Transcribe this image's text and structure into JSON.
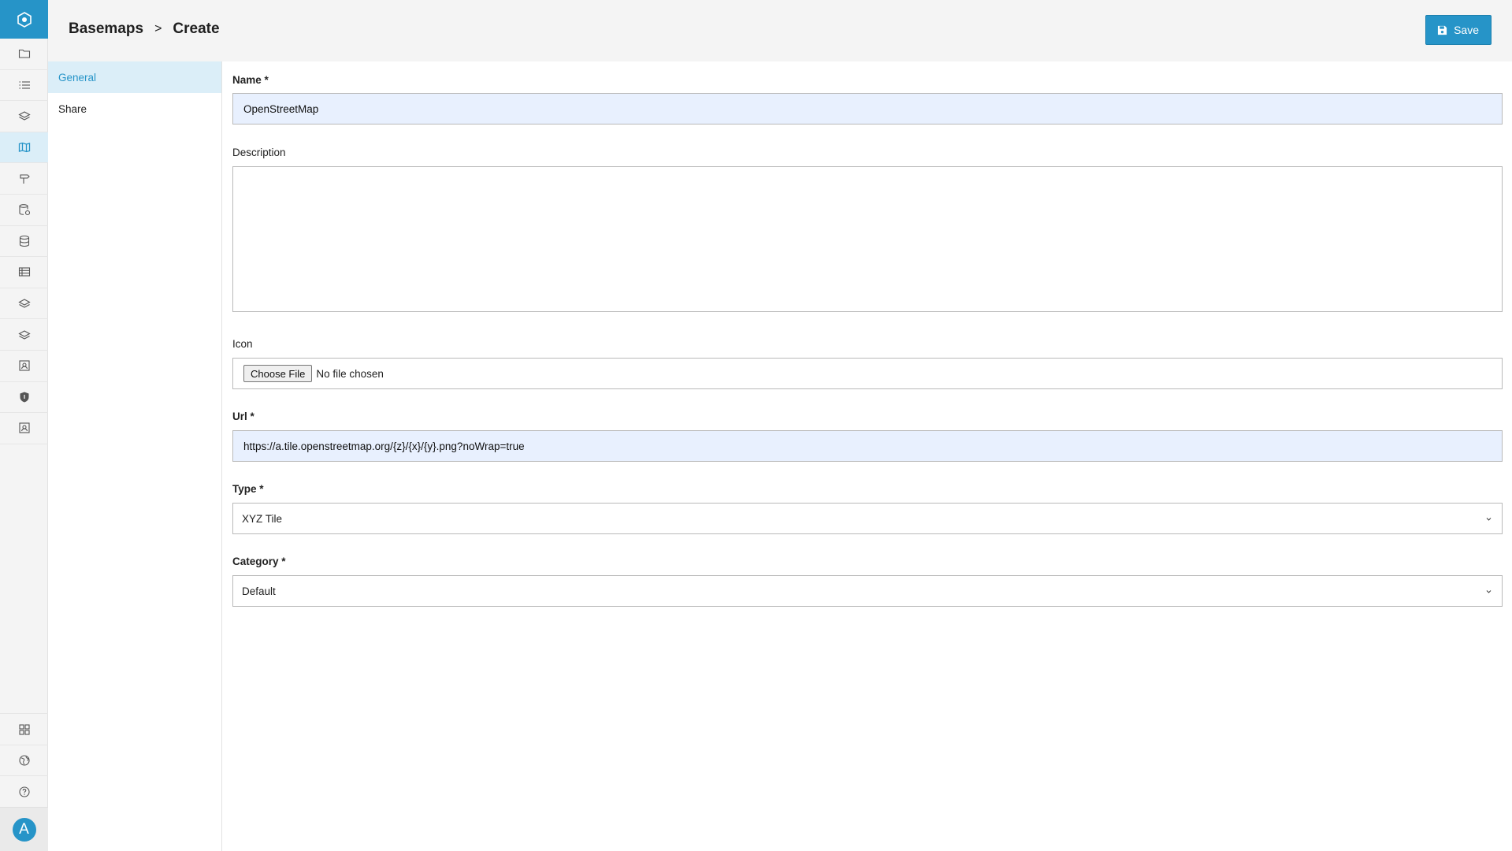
{
  "breadcrumb": {
    "root": "Basemaps",
    "separator": ">",
    "current": "Create"
  },
  "toolbar": {
    "save_label": "Save"
  },
  "subnav": {
    "items": [
      {
        "label": "General",
        "active": true
      },
      {
        "label": "Share",
        "active": false
      }
    ]
  },
  "rail": {
    "logo_icon": "hexagon-logo-icon",
    "items": [
      "folder-icon",
      "list-icon",
      "layers-icon",
      "map-icon",
      "signpost-icon",
      "database-stack-icon",
      "database-icon",
      "table-icon",
      "layers-icon",
      "layers-icon",
      "contact-card-icon",
      "shield-icon",
      "contact-card-icon"
    ],
    "active_item": "map-icon",
    "bottom_items": [
      "grid-icon",
      "globe-icon",
      "help-icon"
    ],
    "avatar_initial": "A"
  },
  "form": {
    "name": {
      "label": "Name *",
      "value": "OpenStreetMap"
    },
    "description": {
      "label": "Description",
      "value": ""
    },
    "icon": {
      "label": "Icon",
      "button_label": "Choose File",
      "status": "No file chosen"
    },
    "url": {
      "label": "Url *",
      "value": "https://a.tile.openstreetmap.org/{z}/{x}/{y}.png?noWrap=true"
    },
    "type": {
      "label": "Type *",
      "selected": "XYZ Tile"
    },
    "category": {
      "label": "Category *",
      "selected": "Default"
    }
  },
  "colors": {
    "accent": "#2694c8",
    "autofill_bg": "#e8f0fe",
    "active_bg": "#dbeef8"
  }
}
